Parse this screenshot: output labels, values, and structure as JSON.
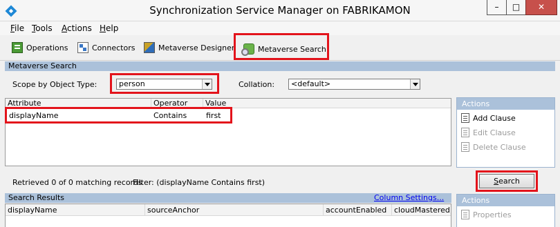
{
  "window": {
    "title": "Synchronization Service Manager on FABRIKAMON",
    "min_glyph": "–",
    "max_glyph": "□",
    "close_glyph": "✕"
  },
  "menu": {
    "items": [
      {
        "underline": "F",
        "rest": "ile"
      },
      {
        "underline": "T",
        "rest": "ools"
      },
      {
        "underline": "A",
        "rest": "ctions"
      },
      {
        "underline": "H",
        "rest": "elp"
      }
    ]
  },
  "toolbar": {
    "operations": "Operations",
    "connectors": "Connectors",
    "metaverse_designer": "Metaverse Designer",
    "metaverse_search": "Metaverse Search"
  },
  "metaverse_search": {
    "header": "Metaverse Search",
    "scope_label": "Scope by Object Type:",
    "scope_value": "person",
    "collation_label": "Collation:",
    "collation_value": "<default>",
    "columns": [
      "Attribute",
      "Operator",
      "Value"
    ],
    "rows": [
      {
        "attribute": "displayName",
        "operator": "Contains",
        "value": "first"
      }
    ]
  },
  "actions": {
    "title": "Actions",
    "add_clause": "Add Clause",
    "edit_clause": "Edit Clause",
    "delete_clause": "Delete Clause"
  },
  "search_button": {
    "underline": "S",
    "rest": "earch"
  },
  "status": {
    "retrieved": "Retrieved 0 of 0 matching records",
    "filter": "Filter: (displayName Contains  first)"
  },
  "search_results": {
    "header": "Search Results",
    "column_settings": "Column Settings...",
    "columns": [
      "displayName",
      "sourceAnchor",
      "accountEnabled",
      "cloudMastered"
    ]
  },
  "results_actions": {
    "title": "Actions",
    "properties": "Properties"
  },
  "colors": {
    "highlight": "#e3131b",
    "section_header": "#abc1da",
    "link": "#0000ee"
  },
  "icons": [
    "app-icon",
    "operations-icon",
    "connectors-icon",
    "metaverse-designer-icon",
    "metaverse-search-icon",
    "add-clause-icon",
    "edit-clause-icon",
    "delete-clause-icon",
    "properties-icon",
    "chevron-down-icon"
  ]
}
